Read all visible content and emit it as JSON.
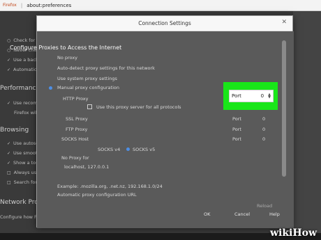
{
  "browser": {
    "app_name": "Firefox",
    "url": "about:preferences"
  },
  "background_page": {
    "items": [
      "Check for up",
      "Never check",
      "Use a backgr",
      "Automatically",
      "Use recomm",
      "Firefox wil",
      "Use autosc",
      "Use smooth",
      "Show a touch",
      "Always use th",
      "Search for te",
      "Configure how Firefox"
    ],
    "headings": [
      "Performance",
      "Browsing",
      "Network Pro"
    ]
  },
  "dialog": {
    "title": "Connection Settings",
    "section_heading": "Configure Proxies to Access the Internet",
    "options": {
      "no_proxy": "No proxy",
      "auto_detect": "Auto-detect proxy settings for this network",
      "system": "Use system proxy settings",
      "manual": "Manual proxy configuration"
    },
    "http_proxy_label": "HTTP Proxy",
    "use_for_all": "Use this proxy server for all protocols",
    "ssl_proxy_label": "SSL Proxy",
    "ftp_proxy_label": "FTP Proxy",
    "socks_host_label": "SOCKS Host",
    "socks_v4": "SOCKS v4",
    "socks_v5": "SOCKS v5",
    "no_proxy_for_label": "No Proxy for",
    "no_proxy_for_value": "localhost, 127.0.0.1",
    "example_text": "Example: .mozilla.org, .net.nz, 192.168.1.0/24",
    "auto_config_label": "Automatic proxy configuration URL",
    "reload_label": "Reload",
    "port_label": "Port",
    "port_http_value": "0",
    "port_ssl_value": "0",
    "port_ftp_value": "0",
    "port_socks_value": "0",
    "buttons": {
      "ok": "OK",
      "cancel": "Cancel",
      "help": "Help"
    }
  },
  "watermark": "wikiHow",
  "colors": {
    "highlight": "#19e619",
    "radio_selected": "#4d8fe6"
  }
}
